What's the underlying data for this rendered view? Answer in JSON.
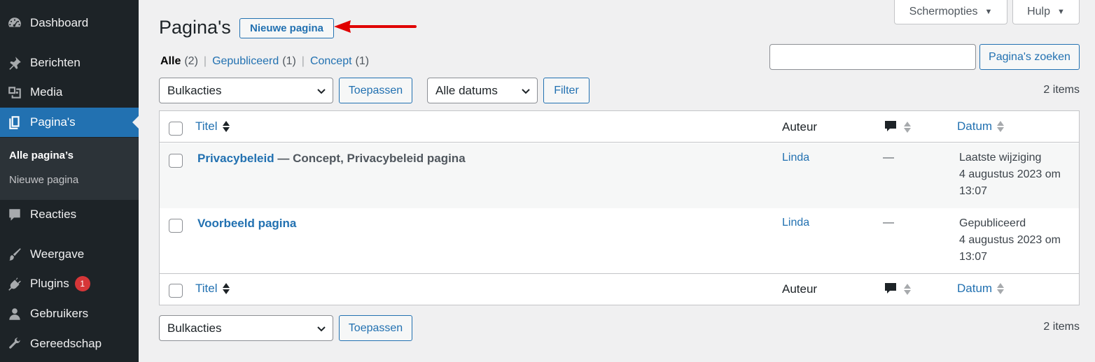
{
  "sidebar": {
    "items": [
      {
        "label": "Dashboard",
        "icon": "dashboard-icon"
      },
      {
        "label": "Berichten",
        "icon": "pin-icon"
      },
      {
        "label": "Media",
        "icon": "media-icon"
      },
      {
        "label": "Pagina's",
        "icon": "pages-icon"
      },
      {
        "label": "Reacties",
        "icon": "comment-icon"
      },
      {
        "label": "Weergave",
        "icon": "brush-icon"
      },
      {
        "label": "Plugins",
        "icon": "plugin-icon",
        "badge": "1"
      },
      {
        "label": "Gebruikers",
        "icon": "user-icon"
      },
      {
        "label": "Gereedschap",
        "icon": "wrench-icon"
      }
    ],
    "submenu": [
      {
        "label": "Alle pagina’s"
      },
      {
        "label": "Nieuwe pagina"
      }
    ]
  },
  "screen_options": {
    "label": "Schermopties"
  },
  "help": {
    "label": "Hulp"
  },
  "header": {
    "title": "Pagina's",
    "add_new": "Nieuwe pagina"
  },
  "views": [
    {
      "label": "Alle",
      "count": "(2)"
    },
    {
      "label": "Gepubliceerd",
      "count": "(1)"
    },
    {
      "label": "Concept",
      "count": "(1)"
    }
  ],
  "search": {
    "value": "",
    "button": "Pagina's zoeken"
  },
  "top_nav": {
    "bulk": "Bulkacties",
    "apply": "Toepassen",
    "dates": "Alle datums",
    "filter": "Filter",
    "count": "2 items"
  },
  "bottom_nav": {
    "bulk": "Bulkacties",
    "apply": "Toepassen",
    "count": "2 items"
  },
  "columns": {
    "title": "Titel",
    "author": "Auteur",
    "date": "Datum"
  },
  "rows": [
    {
      "title": "Privacybeleid",
      "state": " — Concept, Privacybeleid pagina",
      "author": "Linda",
      "comments": "—",
      "date_status": "Laatste wijziging",
      "date_line1": "4 augustus 2023 om",
      "date_line2": "13:07"
    },
    {
      "title": "Voorbeeld pagina",
      "state": "",
      "author": "Linda",
      "comments": "—",
      "date_status": "Gepubliceerd",
      "date_line1": "4 augustus 2023 om",
      "date_line2": "13:07"
    }
  ],
  "colors": {
    "sidebar_bg": "#1d2327",
    "accent": "#2271b1",
    "badge": "#d63638",
    "arrow": "#e00000"
  }
}
